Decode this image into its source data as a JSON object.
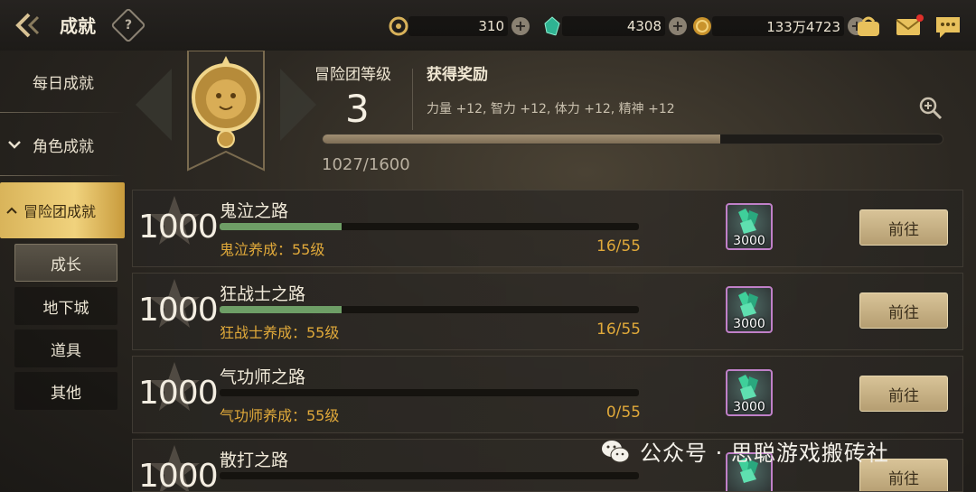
{
  "header": {
    "title": "成就",
    "help_glyph": "?",
    "currencies": [
      {
        "icon": "chaos-coin-icon",
        "amount": "310"
      },
      {
        "icon": "green-crystal-icon",
        "amount": "4308"
      },
      {
        "icon": "gold-coin-icon",
        "amount": "133万4723"
      }
    ],
    "plus_glyph": "+"
  },
  "sidebar": {
    "items": [
      {
        "label": "每日成就"
      },
      {
        "label": "角色成就"
      },
      {
        "label": "冒险团成就"
      }
    ],
    "sub_items": [
      {
        "label": "成长"
      },
      {
        "label": "地下城"
      },
      {
        "label": "道具"
      },
      {
        "label": "其他"
      }
    ]
  },
  "level_panel": {
    "level_label": "冒险团等级",
    "level_value": "3",
    "reward_label": "获得奖励",
    "reward_text": "力量 +12, 智力 +12, 体力 +12, 精神 +12",
    "xp_text": "1027/1600",
    "xp_current": 1027,
    "xp_max": 1600
  },
  "achievements": [
    {
      "points": "1000",
      "title": "鬼泣之路",
      "desc": "鬼泣养成：55级",
      "count": "16/55",
      "progress": 0.2909,
      "reward_qty": "3000",
      "button": "前往"
    },
    {
      "points": "1000",
      "title": "狂战士之路",
      "desc": "狂战士养成：55级",
      "count": "16/55",
      "progress": 0.2909,
      "reward_qty": "3000",
      "button": "前往"
    },
    {
      "points": "1000",
      "title": "气功师之路",
      "desc": "气功师养成：55级",
      "count": "0/55",
      "progress": 0,
      "reward_qty": "3000",
      "button": "前往"
    },
    {
      "points": "1000",
      "title": "散打之路",
      "desc": "",
      "count": "",
      "progress": 0,
      "reward_qty": "",
      "button": "前往"
    }
  ],
  "watermark": "公众号 · 思聪游戏搬砖社",
  "colors": {
    "accent_gold": "#e0a93a",
    "progress_green": "#6e9e66",
    "reward_border": "#c080c8"
  }
}
